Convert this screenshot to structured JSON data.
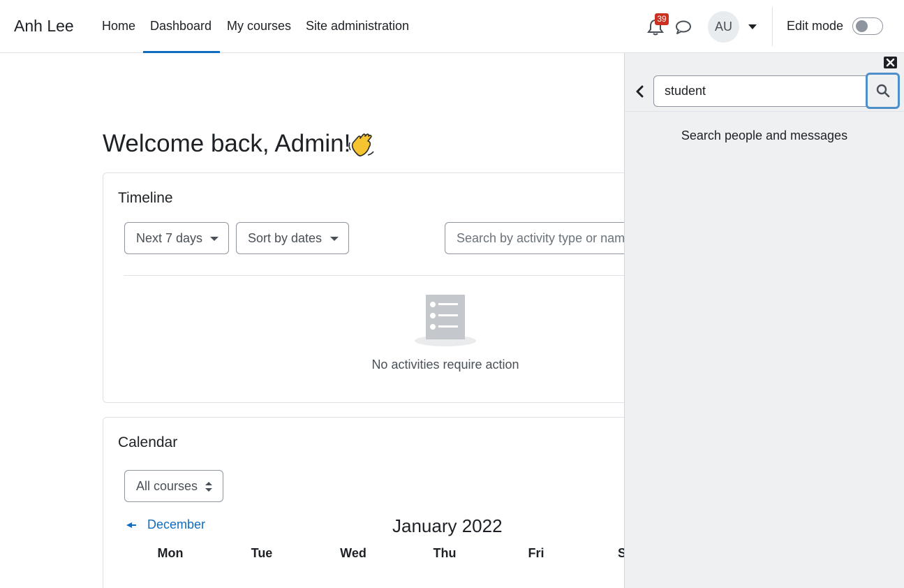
{
  "navbar": {
    "brand": "Anh Lee",
    "links": [
      {
        "label": "Home",
        "active": false
      },
      {
        "label": "Dashboard",
        "active": true
      },
      {
        "label": "My courses",
        "active": false
      },
      {
        "label": "Site administration",
        "active": false
      }
    ],
    "notifications_count": "39",
    "notifications_icon": "bell-icon",
    "messages_icon": "chat-bubble-icon",
    "user_initials": "AU",
    "edit_mode_label": "Edit mode",
    "edit_mode_on": false
  },
  "main": {
    "welcome": "Welcome back, Admin!",
    "welcome_emoji": "waving-hand-icon",
    "timeline": {
      "title": "Timeline",
      "filter_label": "Next 7 days",
      "sort_label": "Sort by dates",
      "search_placeholder": "Search by activity type or name",
      "empty_text": "No activities require action"
    },
    "calendar": {
      "title": "Calendar",
      "course_select": "All courses",
      "prev_month": "December",
      "month_title": "January 2022",
      "day_headers": [
        "Mon",
        "Tue",
        "Wed",
        "Thu",
        "Fri",
        "Sat"
      ]
    }
  },
  "drawer": {
    "search_value": "student",
    "hint": "Search people and messages"
  },
  "colors": {
    "accent": "#0f6cbf",
    "badge": "#ca3120",
    "drawer_bg": "#eff0f2",
    "focus_ring": "#4e8fc9"
  }
}
